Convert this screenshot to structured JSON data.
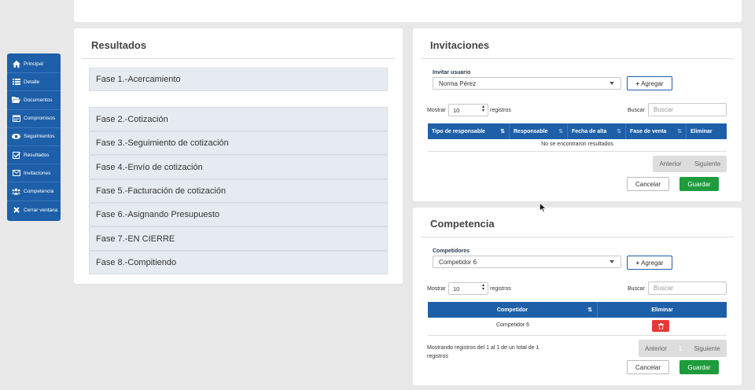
{
  "sidebar": {
    "items": [
      {
        "label": "Principal",
        "icon": "home-icon"
      },
      {
        "label": "Detalle",
        "icon": "list-icon"
      },
      {
        "label": "Documentos",
        "icon": "folder-icon"
      },
      {
        "label": "Compromisos",
        "icon": "calendar-icon"
      },
      {
        "label": "Seguimientos",
        "icon": "eye-icon"
      },
      {
        "label": "Resultados",
        "icon": "checkbox-icon"
      },
      {
        "label": "Invitaciones",
        "icon": "envelope-icon"
      },
      {
        "label": "Competencia",
        "icon": "users-icon"
      },
      {
        "label": "Cerrar ventana",
        "icon": "close-icon"
      }
    ]
  },
  "resultados": {
    "title": "Resultados",
    "phases": [
      "Fase 1.-Acercamiento",
      "Fase 2.-Cotización",
      "Fase 3.-Seguimiento de cotización",
      "Fase 4.-Envío de cotización",
      "Fase 5.-Facturación de cotización",
      "Fase 6.-Asignando Presupuesto",
      "Fase 7.-EN CIERRE",
      "Fase 8.-Compitiendo"
    ]
  },
  "invitaciones": {
    "title": "Invitaciones",
    "field_label": "Invitar usuario",
    "selected_user": "Norma Pérez",
    "add_label": "Agregar",
    "show_label": "Mostrar",
    "page_size": "10",
    "records_label": "registros",
    "search_label": "Buscar",
    "search_placeholder": "Buscar",
    "columns": [
      "Tipo de responsable",
      "Responsable",
      "Fecha de alta",
      "Fase de venta",
      "Eliminar"
    ],
    "empty_message": "No se encontraron resultados",
    "prev_label": "Anterior",
    "next_label": "Siguiente",
    "cancel_label": "Cancelar",
    "save_label": "Guardar"
  },
  "competencia": {
    "title": "Competencia",
    "field_label": "Competidores",
    "selected_competitor": "Competidor 6",
    "add_label": "Agregar",
    "show_label": "Mostrar",
    "page_size": "10",
    "records_label": "registros",
    "search_label": "Buscar",
    "search_placeholder": "Buscar",
    "columns": [
      "Competidor",
      "Eliminar"
    ],
    "rows": [
      {
        "competidor": "Competidor 6"
      }
    ],
    "info_line1": "Mostrando registros del 1 al 1 de un total de 1",
    "info_line2": "registros",
    "prev_label": "Anterior",
    "page_number": "1",
    "next_label": "Siguiente",
    "cancel_label": "Cancelar",
    "save_label": "Guardar"
  },
  "colors": {
    "primary": "#1d5fa8",
    "success": "#1e9b3c",
    "danger": "#e53935"
  }
}
